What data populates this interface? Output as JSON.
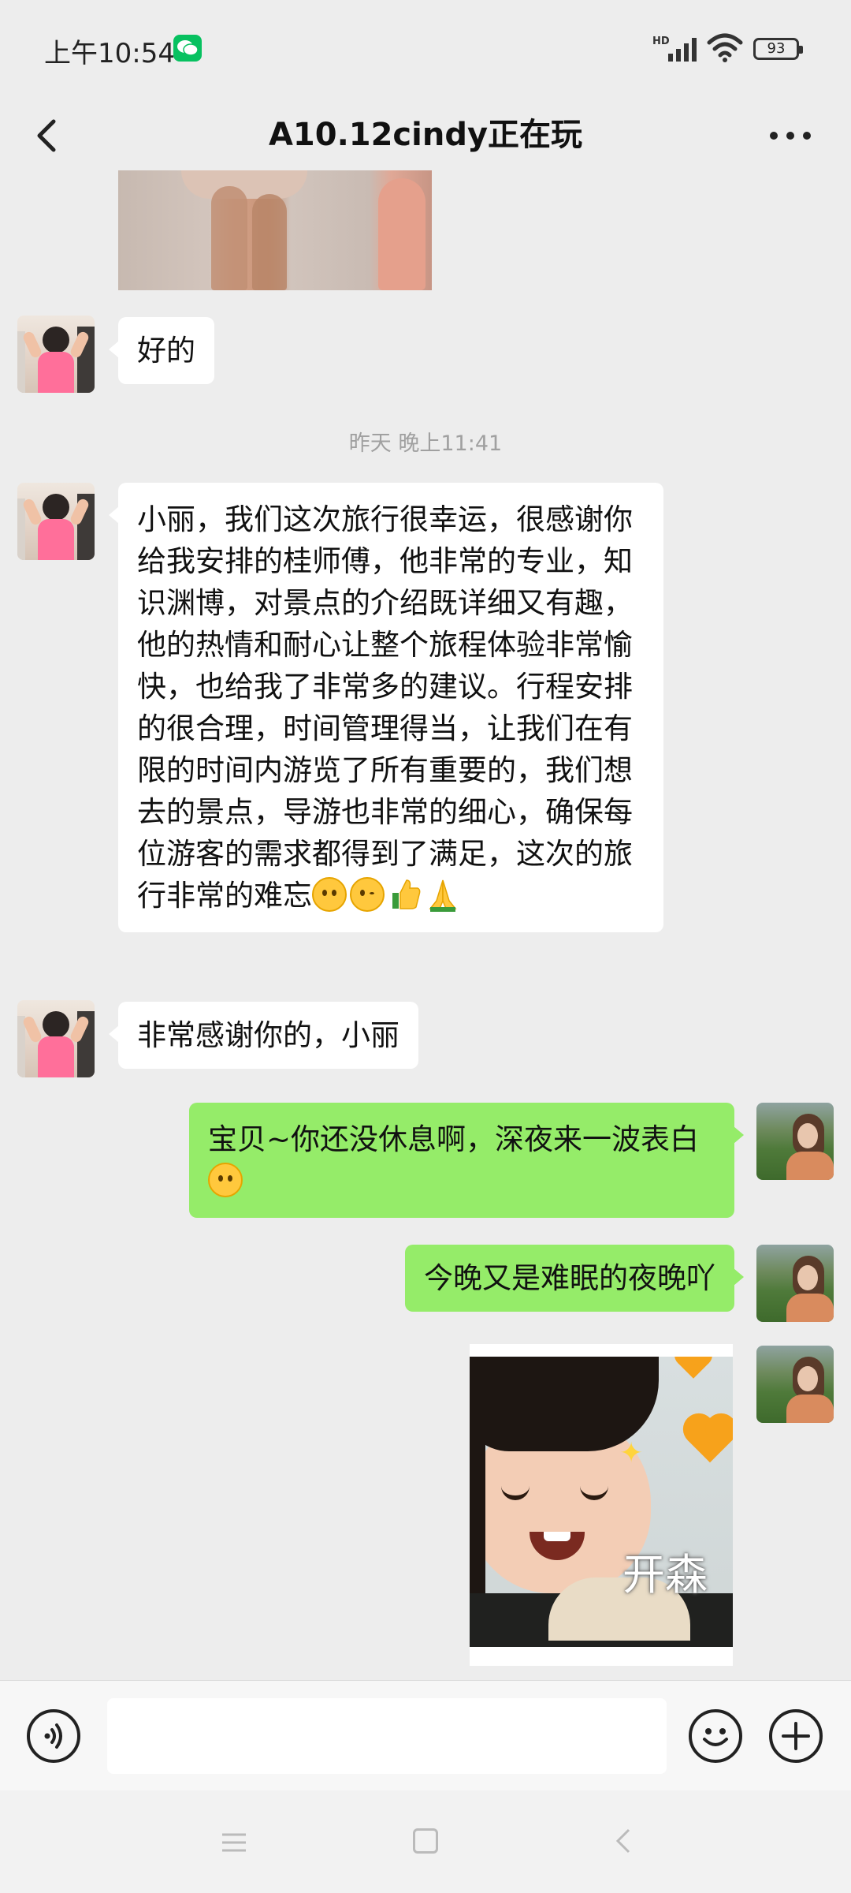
{
  "status_bar": {
    "time": "上午10:54",
    "network": "HD",
    "battery": "93"
  },
  "header": {
    "title": "A10.12cindy正在玩"
  },
  "messages": [
    {
      "side": "left",
      "text": "好的"
    },
    {
      "timestamp": "昨天 晚上11:41"
    },
    {
      "side": "left",
      "text": "小丽，我们这次旅行很幸运，很感谢你给我安排的桂师傅，他非常的专业，知识渊博，对景点的介绍既详细又有趣，他的热情和耐心让整个旅程体验非常愉快，也给我了非常多的建议。行程安排的很合理，时间管理得当，让我们在有限的时间内游览了所有重要的，我们想去的景点，导游也非常的细心，确保每位游客的需求都得到了满足，这次的旅行非常的难忘",
      "emojis": [
        "grin-emoji",
        "wink-emoji",
        "thumbs-up-emoji",
        "pray-emoji"
      ]
    },
    {
      "side": "left",
      "text": "非常感谢你的，小丽"
    },
    {
      "side": "right",
      "text": "宝贝~你还没休息啊，深夜来一波表白",
      "emojis": [
        "smile-emoji"
      ]
    },
    {
      "side": "right",
      "text": "今晚又是难眠的夜晚吖"
    },
    {
      "side": "right",
      "sticker_caption": "开森"
    }
  ],
  "colors": {
    "background": "#ededed",
    "bubble_left": "#ffffff",
    "bubble_right": "#95ec69",
    "wechat_green": "#07c160"
  }
}
